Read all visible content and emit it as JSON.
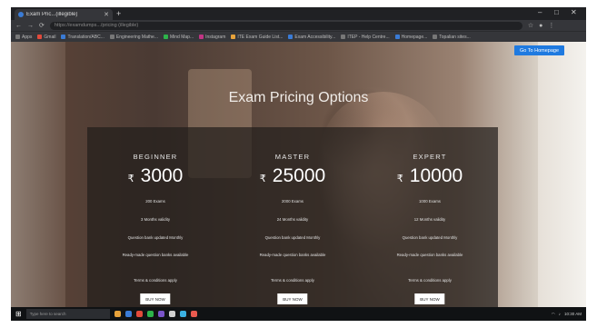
{
  "browser": {
    "tab_title": "Exam Pric...(illegible)",
    "new_tab_label": "+",
    "window_controls": [
      "–",
      "□",
      "✕"
    ],
    "url": "https://examdumps.../pricing (illegible)",
    "nav_icons": [
      "←",
      "→",
      "⟳"
    ],
    "bookmarks": [
      "Apps",
      "Gmail",
      "Translation/ABC...",
      "Engineering Mathe...",
      "Mind Map...",
      "Instagram",
      "ITE Exam Guide List...",
      "Exam Accessibility...",
      "ITEP - Help Centre...",
      "Homepage...",
      "Topalian sites..."
    ]
  },
  "page": {
    "visit_button": "Go To Homepage",
    "title": "Exam Pricing Options",
    "currency_symbol": "₹",
    "plans": [
      {
        "name": "BEGINNER",
        "price": "3000",
        "features": [
          "200 Exams",
          "3 Months validity",
          "Question bank updated Monthly",
          "Ready-made question banks available",
          "Terms & conditions apply"
        ],
        "cta": "BUY NOW"
      },
      {
        "name": "MASTER",
        "price": "25000",
        "features": [
          "2000 Exams",
          "24 Months validity",
          "Question bank updated Monthly",
          "Ready-made question banks available",
          "Terms & conditions apply"
        ],
        "cta": "BUY NOW"
      },
      {
        "name": "EXPERT",
        "price": "10000",
        "features": [
          "1000 Exams",
          "12 Months validity",
          "Question bank updated Monthly",
          "Ready-made question banks available",
          "Terms & conditions apply"
        ],
        "cta": "BUY NOW"
      }
    ]
  },
  "taskbar": {
    "start_icon": "windows-icon",
    "search_placeholder": "Type here to search",
    "app_colors": [
      "#e8a33b",
      "#3a7bd5",
      "#e24a3b",
      "#2db34a",
      "#7a54c9",
      "#d0d0d0",
      "#3ab0e2",
      "#e85a4f"
    ],
    "clock": "10:30 AM"
  }
}
